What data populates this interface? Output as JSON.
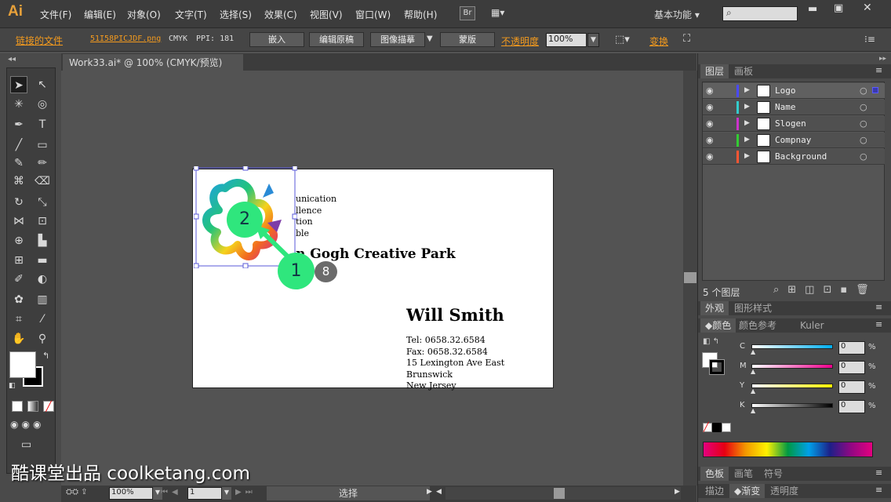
{
  "app": {
    "logo": "Ai",
    "workspace": "基本功能"
  },
  "menu": [
    "文件(F)",
    "编辑(E)",
    "对象(O)",
    "文字(T)",
    "选择(S)",
    "效果(C)",
    "视图(V)",
    "窗口(W)",
    "帮助(H)"
  ],
  "bridge": "Br",
  "control": {
    "linked_file": "链接的文件",
    "filename": "51I58PICJDF.png",
    "mode": "CMYK",
    "ppi_label": "PPI: 181",
    "embed": "嵌入",
    "edit_original": "编辑原稿",
    "image_trace": "图像描摹",
    "mask": "蒙版",
    "opacity_label": "不透明度",
    "opacity_value": "100%",
    "transform": "变换"
  },
  "document": {
    "tab": "Work33.ai* @ 100% (CMYK/预览)",
    "close": "×"
  },
  "artboard": {
    "lines": [
      "unication",
      "llence",
      "tion",
      "ble"
    ],
    "park": "n Gogh Creative Park",
    "name": "Will Smith",
    "contact": [
      "Tel: 0658.32.6584",
      "Fax: 0658.32.6584",
      "15 Lexington Ave East Brunswick",
      "New Jersey"
    ]
  },
  "markers": {
    "m1": "1",
    "m2": "2",
    "m8": "8"
  },
  "layers_panel": {
    "tab1": "图层",
    "tab2": "画板",
    "count": "5 个图层",
    "layers": [
      "Logo",
      "Name",
      "Slogen",
      "Compnay",
      "Background"
    ],
    "colors": [
      "#4a4aff",
      "#33cccc",
      "#cc33cc",
      "#33cc33",
      "#ff5533"
    ]
  },
  "appearance": {
    "tab1": "外观",
    "tab2": "图形样式"
  },
  "color_panel": {
    "tab1": "颜色",
    "tab2": "颜色参考",
    "tab3": "Kuler",
    "channels": [
      {
        "label": "C",
        "value": "0"
      },
      {
        "label": "M",
        "value": "0"
      },
      {
        "label": "Y",
        "value": "0"
      },
      {
        "label": "K",
        "value": "0"
      }
    ],
    "pct": "%"
  },
  "bottom_tabs": {
    "a1": "色板",
    "a2": "画笔",
    "a3": "符号",
    "b1": "描边",
    "b2": "渐变",
    "b3": "透明度"
  },
  "status": {
    "zoom": "100%",
    "page": "1",
    "tool": "选择"
  },
  "watermark": "酷课堂出品 coolketang.com"
}
